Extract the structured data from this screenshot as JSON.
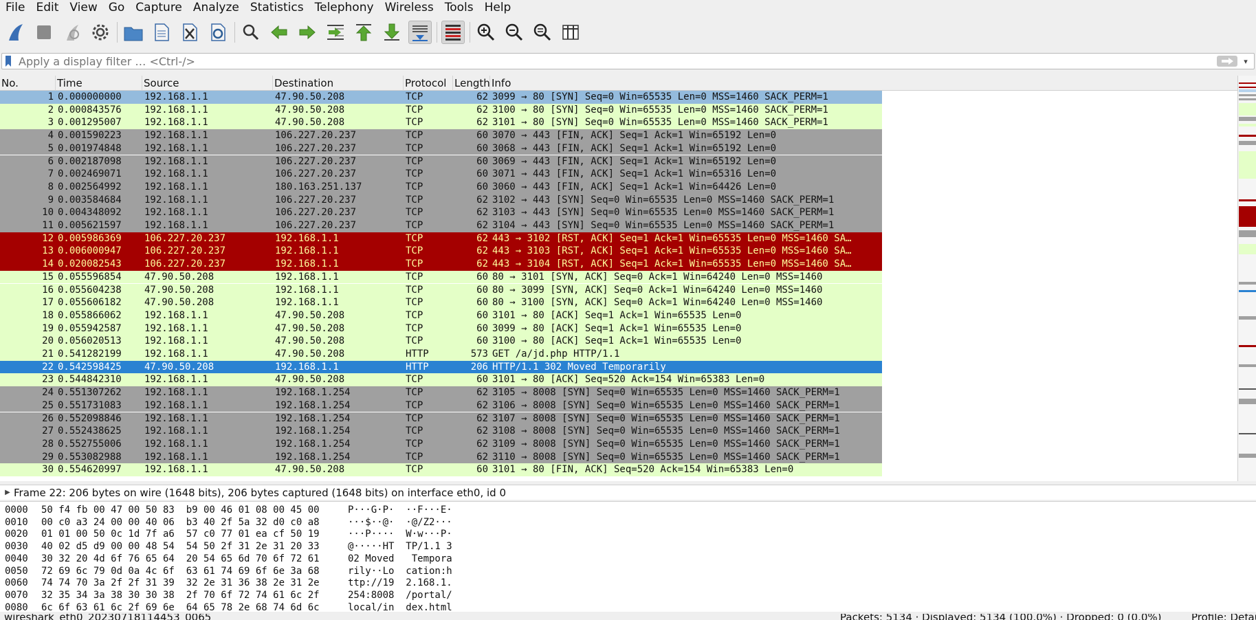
{
  "menu": [
    "File",
    "Edit",
    "View",
    "Go",
    "Capture",
    "Analyze",
    "Statistics",
    "Telephony",
    "Wireless",
    "Tools",
    "Help"
  ],
  "filter": {
    "placeholder": "Apply a display filter … <Ctrl-/>",
    "apply_icon": "arrow-right-icon"
  },
  "columns": [
    "No.",
    "Time",
    "Source",
    "Destination",
    "Protocol",
    "Length",
    "Info"
  ],
  "colors": {
    "selected": "#2a82d2",
    "first_row": "#94bbdd",
    "tcp_green": "#e4ffc7",
    "gray": "#a0a0a0",
    "rst_red": "#a40000",
    "rst_text": "#fffc9c",
    "http_green": "#e4ffc7"
  },
  "packets": [
    {
      "no": "1",
      "time": "0.000000000",
      "source": "192.168.1.1",
      "destination": "47.90.50.208",
      "protocol": "TCP",
      "length": "62",
      "info": "3099 → 80 [SYN] Seq=0 Win=65535 Len=0 MSS=1460 SACK_PERM=1",
      "style": "first"
    },
    {
      "no": "2",
      "time": "0.000843576",
      "source": "192.168.1.1",
      "destination": "47.90.50.208",
      "protocol": "TCP",
      "length": "62",
      "info": "3100 → 80 [SYN] Seq=0 Win=65535 Len=0 MSS=1460 SACK_PERM=1",
      "style": "green"
    },
    {
      "no": "3",
      "time": "0.001295007",
      "source": "192.168.1.1",
      "destination": "47.90.50.208",
      "protocol": "TCP",
      "length": "62",
      "info": "3101 → 80 [SYN] Seq=0 Win=65535 Len=0 MSS=1460 SACK_PERM=1",
      "style": "green"
    },
    {
      "no": "4",
      "time": "0.001590223",
      "source": "192.168.1.1",
      "destination": "106.227.20.237",
      "protocol": "TCP",
      "length": "60",
      "info": "3070 → 443 [FIN, ACK] Seq=1 Ack=1 Win=65192 Len=0",
      "style": "gray"
    },
    {
      "no": "5",
      "time": "0.001974848",
      "source": "192.168.1.1",
      "destination": "106.227.20.237",
      "protocol": "TCP",
      "length": "60",
      "info": "3068 → 443 [FIN, ACK] Seq=1 Ack=1 Win=65192 Len=0",
      "style": "gray"
    },
    {
      "no": "6",
      "time": "0.002187098",
      "source": "192.168.1.1",
      "destination": "106.227.20.237",
      "protocol": "TCP",
      "length": "60",
      "info": "3069 → 443 [FIN, ACK] Seq=1 Ack=1 Win=65192 Len=0",
      "style": "gray"
    },
    {
      "no": "7",
      "time": "0.002469071",
      "source": "192.168.1.1",
      "destination": "106.227.20.237",
      "protocol": "TCP",
      "length": "60",
      "info": "3071 → 443 [FIN, ACK] Seq=1 Ack=1 Win=65316 Len=0",
      "style": "gray"
    },
    {
      "no": "8",
      "time": "0.002564992",
      "source": "192.168.1.1",
      "destination": "180.163.251.137",
      "protocol": "TCP",
      "length": "60",
      "info": "3060 → 443 [FIN, ACK] Seq=1 Ack=1 Win=64426 Len=0",
      "style": "gray"
    },
    {
      "no": "9",
      "time": "0.003584684",
      "source": "192.168.1.1",
      "destination": "106.227.20.237",
      "protocol": "TCP",
      "length": "62",
      "info": "3102 → 443 [SYN] Seq=0 Win=65535 Len=0 MSS=1460 SACK_PERM=1",
      "style": "gray"
    },
    {
      "no": "10",
      "time": "0.004348092",
      "source": "192.168.1.1",
      "destination": "106.227.20.237",
      "protocol": "TCP",
      "length": "62",
      "info": "3103 → 443 [SYN] Seq=0 Win=65535 Len=0 MSS=1460 SACK_PERM=1",
      "style": "gray"
    },
    {
      "no": "11",
      "time": "0.005621597",
      "source": "192.168.1.1",
      "destination": "106.227.20.237",
      "protocol": "TCP",
      "length": "62",
      "info": "3104 → 443 [SYN] Seq=0 Win=65535 Len=0 MSS=1460 SACK_PERM=1",
      "style": "gray"
    },
    {
      "no": "12",
      "time": "0.005986369",
      "source": "106.227.20.237",
      "destination": "192.168.1.1",
      "protocol": "TCP",
      "length": "62",
      "info": "443 → 3102 [RST, ACK] Seq=1 Ack=1 Win=65535 Len=0 MSS=1460 SA…",
      "style": "red"
    },
    {
      "no": "13",
      "time": "0.006000947",
      "source": "106.227.20.237",
      "destination": "192.168.1.1",
      "protocol": "TCP",
      "length": "62",
      "info": "443 → 3103 [RST, ACK] Seq=1 Ack=1 Win=65535 Len=0 MSS=1460 SA…",
      "style": "red"
    },
    {
      "no": "14",
      "time": "0.020082543",
      "source": "106.227.20.237",
      "destination": "192.168.1.1",
      "protocol": "TCP",
      "length": "62",
      "info": "443 → 3104 [RST, ACK] Seq=1 Ack=1 Win=65535 Len=0 MSS=1460 SA…",
      "style": "red"
    },
    {
      "no": "15",
      "time": "0.055596854",
      "source": "47.90.50.208",
      "destination": "192.168.1.1",
      "protocol": "TCP",
      "length": "60",
      "info": "80 → 3101 [SYN, ACK] Seq=0 Ack=1 Win=64240 Len=0 MSS=1460",
      "style": "green"
    },
    {
      "no": "16",
      "time": "0.055604238",
      "source": "47.90.50.208",
      "destination": "192.168.1.1",
      "protocol": "TCP",
      "length": "60",
      "info": "80 → 3099 [SYN, ACK] Seq=0 Ack=1 Win=64240 Len=0 MSS=1460",
      "style": "green"
    },
    {
      "no": "17",
      "time": "0.055606182",
      "source": "47.90.50.208",
      "destination": "192.168.1.1",
      "protocol": "TCP",
      "length": "60",
      "info": "80 → 3100 [SYN, ACK] Seq=0 Ack=1 Win=64240 Len=0 MSS=1460",
      "style": "green"
    },
    {
      "no": "18",
      "time": "0.055866062",
      "source": "192.168.1.1",
      "destination": "47.90.50.208",
      "protocol": "TCP",
      "length": "60",
      "info": "3101 → 80 [ACK] Seq=1 Ack=1 Win=65535 Len=0",
      "style": "green"
    },
    {
      "no": "19",
      "time": "0.055942587",
      "source": "192.168.1.1",
      "destination": "47.90.50.208",
      "protocol": "TCP",
      "length": "60",
      "info": "3099 → 80 [ACK] Seq=1 Ack=1 Win=65535 Len=0",
      "style": "green"
    },
    {
      "no": "20",
      "time": "0.056020513",
      "source": "192.168.1.1",
      "destination": "47.90.50.208",
      "protocol": "TCP",
      "length": "60",
      "info": "3100 → 80 [ACK] Seq=1 Ack=1 Win=65535 Len=0",
      "style": "green"
    },
    {
      "no": "21",
      "time": "0.541282199",
      "source": "192.168.1.1",
      "destination": "47.90.50.208",
      "protocol": "HTTP",
      "length": "573",
      "info": "GET /a/jd.php HTTP/1.1",
      "style": "green"
    },
    {
      "no": "22",
      "time": "0.542598425",
      "source": "47.90.50.208",
      "destination": "192.168.1.1",
      "protocol": "HTTP",
      "length": "206",
      "info": "HTTP/1.1 302 Moved Temporarily",
      "style": "selected"
    },
    {
      "no": "23",
      "time": "0.544842310",
      "source": "192.168.1.1",
      "destination": "47.90.50.208",
      "protocol": "TCP",
      "length": "60",
      "info": "3101 → 80 [ACK] Seq=520 Ack=154 Win=65383 Len=0",
      "style": "green"
    },
    {
      "no": "24",
      "time": "0.551307262",
      "source": "192.168.1.1",
      "destination": "192.168.1.254",
      "protocol": "TCP",
      "length": "62",
      "info": "3105 → 8008 [SYN] Seq=0 Win=65535 Len=0 MSS=1460 SACK_PERM=1",
      "style": "gray"
    },
    {
      "no": "25",
      "time": "0.551731083",
      "source": "192.168.1.1",
      "destination": "192.168.1.254",
      "protocol": "TCP",
      "length": "62",
      "info": "3106 → 8008 [SYN] Seq=0 Win=65535 Len=0 MSS=1460 SACK_PERM=1",
      "style": "gray"
    },
    {
      "no": "26",
      "time": "0.552098846",
      "source": "192.168.1.1",
      "destination": "192.168.1.254",
      "protocol": "TCP",
      "length": "62",
      "info": "3107 → 8008 [SYN] Seq=0 Win=65535 Len=0 MSS=1460 SACK_PERM=1",
      "style": "gray"
    },
    {
      "no": "27",
      "time": "0.552438625",
      "source": "192.168.1.1",
      "destination": "192.168.1.254",
      "protocol": "TCP",
      "length": "62",
      "info": "3108 → 8008 [SYN] Seq=0 Win=65535 Len=0 MSS=1460 SACK_PERM=1",
      "style": "gray"
    },
    {
      "no": "28",
      "time": "0.552755006",
      "source": "192.168.1.1",
      "destination": "192.168.1.254",
      "protocol": "TCP",
      "length": "62",
      "info": "3109 → 8008 [SYN] Seq=0 Win=65535 Len=0 MSS=1460 SACK_PERM=1",
      "style": "gray"
    },
    {
      "no": "29",
      "time": "0.553082988",
      "source": "192.168.1.1",
      "destination": "192.168.1.254",
      "protocol": "TCP",
      "length": "62",
      "info": "3110 → 8008 [SYN] Seq=0 Win=65535 Len=0 MSS=1460 SACK_PERM=1",
      "style": "gray"
    },
    {
      "no": "30",
      "time": "0.554620997",
      "source": "192.168.1.1",
      "destination": "47.90.50.208",
      "protocol": "TCP",
      "length": "60",
      "info": "3101 → 80 [FIN, ACK] Seq=520 Ack=154 Win=65383 Len=0",
      "style": "green"
    }
  ],
  "details": {
    "frame_summary": "Frame 22: 206 bytes on wire (1648 bits), 206 bytes captured (1648 bits) on interface eth0, id 0"
  },
  "hex_rows": [
    {
      "offset": "0000",
      "bytes": "50 f4 fb 00 47 00 50 83  b9 00 46 01 08 00 45 00",
      "ascii": "P···G·P·  ··F···E·"
    },
    {
      "offset": "0010",
      "bytes": "00 c0 a3 24 00 00 40 06  b3 40 2f 5a 32 d0 c0 a8",
      "ascii": "···$··@·  ·@/Z2···"
    },
    {
      "offset": "0020",
      "bytes": "01 01 00 50 0c 1d 7f a6  57 c0 77 01 ea cf 50 19",
      "ascii": "···P····  W·w···P·"
    },
    {
      "offset": "0030",
      "bytes": "40 02 d5 d9 00 00 48 54  54 50 2f 31 2e 31 20 33",
      "ascii": "@·····HT  TP/1.1 3"
    },
    {
      "offset": "0040",
      "bytes": "30 32 20 4d 6f 76 65 64  20 54 65 6d 70 6f 72 61",
      "ascii": "02 Moved   Tempora"
    },
    {
      "offset": "0050",
      "bytes": "72 69 6c 79 0d 0a 4c 6f  63 61 74 69 6f 6e 3a 68",
      "ascii": "rily··Lo  cation:h"
    },
    {
      "offset": "0060",
      "bytes": "74 74 70 3a 2f 2f 31 39  32 2e 31 36 38 2e 31 2e",
      "ascii": "ttp://19  2.168.1."
    },
    {
      "offset": "0070",
      "bytes": "32 35 34 3a 38 30 30 38  2f 70 6f 72 74 61 6c 2f",
      "ascii": "254:8008  /portal/"
    },
    {
      "offset": "0080",
      "bytes": "6c 6f 63 61 6c 2f 69 6e  64 65 78 2e 68 74 6d 6c",
      "ascii": "local/in  dex.html"
    }
  ],
  "status": {
    "left": "wireshark_eth0_20230718114453_0065",
    "right": "Packets: 5134 · Displayed: 5134 (100.0%) · Dropped: 0 (0.0%)",
    "profile": "Profile: Default"
  }
}
